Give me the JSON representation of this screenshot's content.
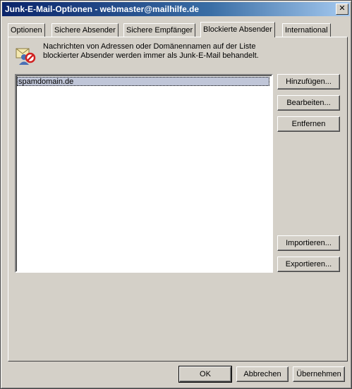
{
  "window": {
    "title": "Junk-E-Mail-Optionen - webmaster@mailhilfe.de",
    "close_label": "✕"
  },
  "tabs": [
    {
      "label": "Optionen",
      "active": false
    },
    {
      "label": "Sichere Absender",
      "active": false
    },
    {
      "label": "Sichere Empfänger",
      "active": false
    },
    {
      "label": "Blockierte Absender",
      "active": true
    },
    {
      "label": "International",
      "active": false
    }
  ],
  "panel": {
    "description_line1": "Nachrichten von Adressen oder Domänennamen auf der Liste",
    "description_line2": "blockierter Absender werden immer als Junk-E-Mail behandelt.",
    "icon": "blocked-senders-icon",
    "list_items": [
      "spamdomain.de"
    ],
    "buttons": {
      "add": "Hinzufügen...",
      "edit": "Bearbeiten...",
      "remove": "Entfernen",
      "import": "Importieren...",
      "export": "Exportieren..."
    }
  },
  "footer": {
    "ok": "OK",
    "cancel": "Abbrechen",
    "apply": "Übernehmen"
  },
  "colors": {
    "title_start": "#0a246a",
    "face": "#d4d0c8",
    "selection": "#c0c6d8"
  }
}
